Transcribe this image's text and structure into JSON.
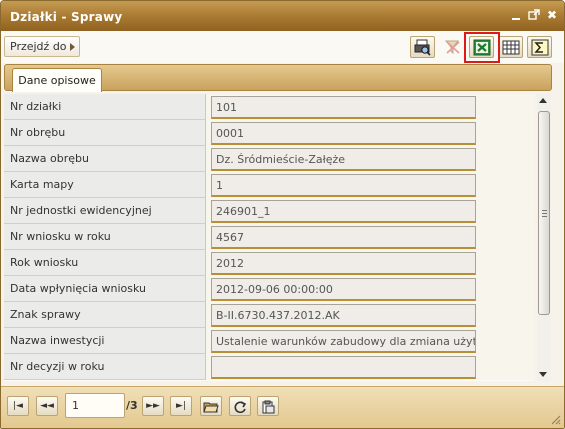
{
  "window": {
    "title": "Działki - Sprawy",
    "controls": {
      "minimize_icon": "minimize-icon",
      "maximize_icon": "popout-icon",
      "close_label": "✖"
    }
  },
  "toolbar": {
    "goto_label": "Przejdź do",
    "buttons": [
      {
        "name": "print-preview-button",
        "icon": "print-preview-icon"
      },
      {
        "name": "clear-filter-button",
        "icon": "clear-filter-icon",
        "disabled": true
      },
      {
        "name": "export-excel-button",
        "icon": "excel-icon",
        "highlighted": true
      },
      {
        "name": "columns-button",
        "icon": "columns-icon"
      },
      {
        "name": "summary-button",
        "icon": "sigma-icon"
      }
    ],
    "highlight_color": "#d81c1c"
  },
  "tabs": [
    {
      "label": "Dane opisowe",
      "active": true
    }
  ],
  "fields": [
    {
      "label": "Nr działki",
      "value": "101"
    },
    {
      "label": "Nr obrębu",
      "value": "0001"
    },
    {
      "label": "Nazwa obrębu",
      "value": "Dz. Śródmieście-Załęże"
    },
    {
      "label": "Karta mapy",
      "value": "1"
    },
    {
      "label": "Nr jednostki ewidencyjnej",
      "value": "246901_1"
    },
    {
      "label": "Nr wniosku w roku",
      "value": "4567"
    },
    {
      "label": "Rok wniosku",
      "value": "2012"
    },
    {
      "label": "Data wpłynięcia wniosku",
      "value": "2012-09-06 00:00:00"
    },
    {
      "label": "Znak sprawy",
      "value": "B-II.6730.437.2012.AK"
    },
    {
      "label": "Nazwa inwestycji",
      "value": "Ustalenie warunków zabudowy dla zmiana użytkowania"
    },
    {
      "label": "Nr decyzji w roku",
      "value": ""
    }
  ],
  "pagination": {
    "current_page": "1",
    "total_label": "/3",
    "first_label": "|◄",
    "prev_label": "◄◄",
    "next_label": "►►",
    "last_label": "►|"
  },
  "colors": {
    "titlebar": "#a7782f",
    "tabbar": "#d4b06c",
    "field_underline": "#b88f35",
    "paging_bar": "#e9d3a0"
  }
}
